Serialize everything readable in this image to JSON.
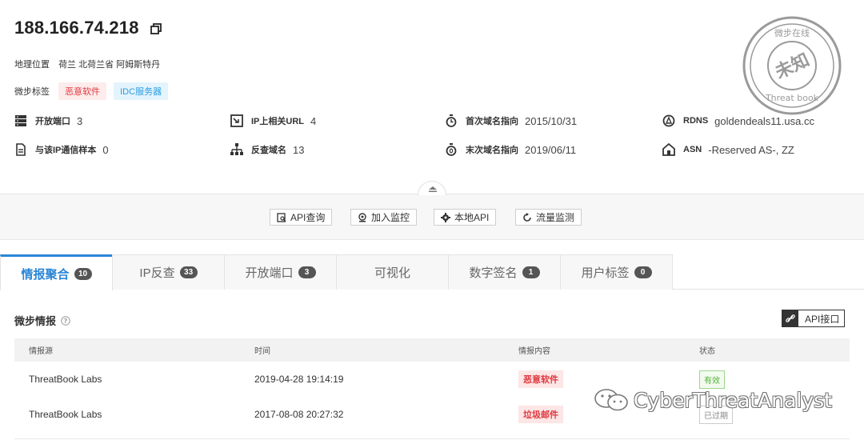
{
  "header": {
    "ip": "188.166.74.218",
    "location_label": "地理位置",
    "location_value": "荷兰 北荷兰省 阿姆斯特丹",
    "tags_label": "微步标签",
    "tags": [
      "恶意软件",
      "IDC服务器"
    ]
  },
  "info": {
    "open_ports_label": "开放端口",
    "open_ports_value": "3",
    "samples_label": "与该IP通信样本",
    "samples_value": "0",
    "url_label": "IP上相关URL",
    "url_value": "4",
    "reverse_label": "反查域名",
    "reverse_value": "13",
    "first_label": "首次域名指向",
    "first_value": "2015/10/31",
    "last_label": "末次域名指向",
    "last_value": "2019/06/11",
    "rdns_label": "RDNS",
    "rdns_value": "goldendeals11.usa.cc",
    "asn_label": "ASN",
    "asn_value": "-Reserved AS-, ZZ"
  },
  "stamp": {
    "center_text": "未知",
    "top_text": "微步在线",
    "bottom_text": "Threat book"
  },
  "toolbar": {
    "api_query": "API查询",
    "add_monitor": "加入监控",
    "local_api": "本地API",
    "traffic_monitor": "流量监测"
  },
  "tabs": [
    {
      "label": "情报聚合",
      "count": "10"
    },
    {
      "label": "IP反查",
      "count": "33"
    },
    {
      "label": "开放端口",
      "count": "3"
    },
    {
      "label": "可视化",
      "count": ""
    },
    {
      "label": "数字签名",
      "count": "1"
    },
    {
      "label": "用户标签",
      "count": "0"
    }
  ],
  "section": {
    "title": "微步情报",
    "api_button": "API接口"
  },
  "table": {
    "columns": [
      "情报源",
      "时间",
      "情报内容",
      "状态"
    ],
    "rows": [
      {
        "source": "ThreatBook Labs",
        "time": "2019-04-28 19:14:19",
        "content": "恶意软件",
        "status": "有效"
      },
      {
        "source": "ThreatBook Labs",
        "time": "2017-08-08 20:27:32",
        "content": "垃圾邮件",
        "status": "已过期"
      }
    ]
  },
  "watermark": "CyberThreatAnalyst",
  "colors": {
    "accent": "#2b86d6",
    "danger": "#e0383e",
    "valid": "#52b13a"
  }
}
